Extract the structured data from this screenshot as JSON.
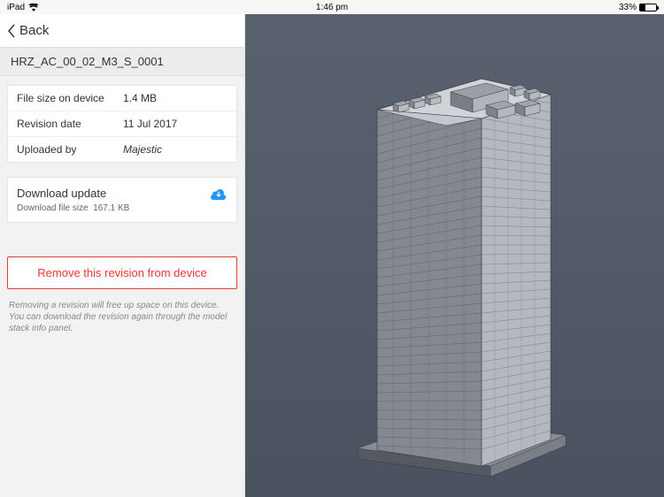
{
  "status": {
    "carrier": "iPad",
    "time": "1:46 pm",
    "battery_pct": "33%"
  },
  "header": {
    "back_label": "Back"
  },
  "title": "HRZ_AC_00_02_M3_S_0001",
  "info": {
    "filesize_label": "File size on device",
    "filesize_value": "1.4 MB",
    "revdate_label": "Revision date",
    "revdate_value": "11 Jul 2017",
    "uploader_label": "Uploaded by",
    "uploader_value": "Majestic"
  },
  "download": {
    "title": "Download update",
    "sub_label": "Download file size",
    "sub_value": "167.1 KB"
  },
  "remove": {
    "button": "Remove this revision from device",
    "note": "Removing a revision will free up space on this device. You can download the revision again through the model stack info panel."
  }
}
